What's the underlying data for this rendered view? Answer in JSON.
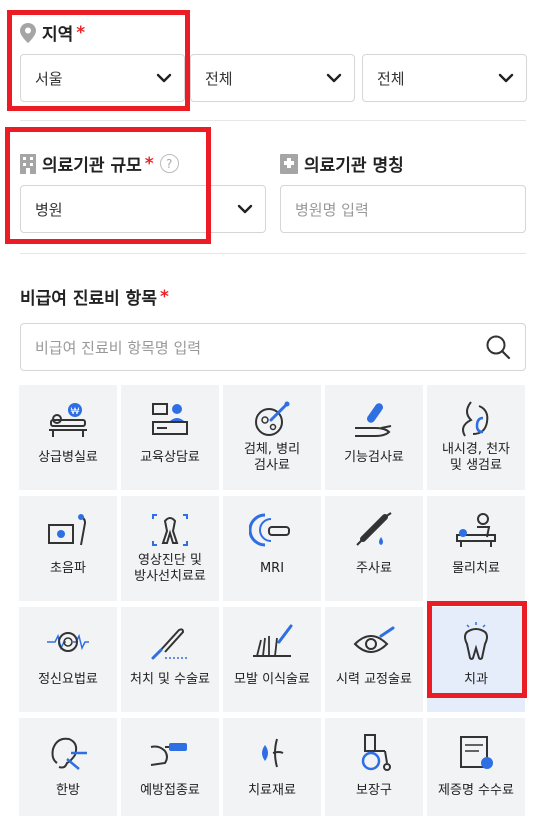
{
  "region": {
    "label": "지역",
    "required_mark": "*",
    "selects": [
      "서울",
      "전체",
      "전체"
    ]
  },
  "institution": {
    "scale_label": "의료기관 규모",
    "scale_required_mark": "*",
    "scale_help": "?",
    "scale_value": "병원",
    "name_label": "의료기관 명칭",
    "name_placeholder": "병원명 입력"
  },
  "items": {
    "label": "비급여 진료비 항목",
    "required_mark": "*",
    "search_placeholder": "비급여 진료비 항목명 입력",
    "categories": [
      {
        "label": "상급병실료",
        "icon": "hospital-bed-icon"
      },
      {
        "label": "교육상담료",
        "icon": "counseling-desk-icon"
      },
      {
        "label": "검체, 병리\n검사료",
        "icon": "specimen-test-icon"
      },
      {
        "label": "기능검사료",
        "icon": "function-test-icon"
      },
      {
        "label": "내시경, 천자\n및 생검료",
        "icon": "endoscope-icon"
      },
      {
        "label": "초음파",
        "icon": "ultrasound-icon"
      },
      {
        "label": "영상진단 및\n방사선치료료",
        "icon": "xray-icon"
      },
      {
        "label": "MRI",
        "icon": "mri-icon"
      },
      {
        "label": "주사료",
        "icon": "syringe-icon"
      },
      {
        "label": "물리치료",
        "icon": "physical-therapy-icon"
      },
      {
        "label": "정신요법료",
        "icon": "brain-icon"
      },
      {
        "label": "처치 및 수술료",
        "icon": "scalpel-icon"
      },
      {
        "label": "모발 이식술료",
        "icon": "hair-transplant-icon"
      },
      {
        "label": "시력 교정술료",
        "icon": "eye-icon"
      },
      {
        "label": "치과",
        "icon": "tooth-icon"
      },
      {
        "label": "한방",
        "icon": "acupuncture-ear-icon"
      },
      {
        "label": "예방접종료",
        "icon": "vaccine-icon"
      },
      {
        "label": "치료재료",
        "icon": "treatment-material-icon"
      },
      {
        "label": "보장구",
        "icon": "wheelchair-icon"
      },
      {
        "label": "제증명 수수료",
        "icon": "certificate-icon"
      }
    ]
  },
  "colors": {
    "required": "#e8252a",
    "highlight": "#ec1c24",
    "icon_blue": "#2f6fe4",
    "cell_bg": "#f2f3f5",
    "cell_selected_bg": "#e5edfb"
  }
}
